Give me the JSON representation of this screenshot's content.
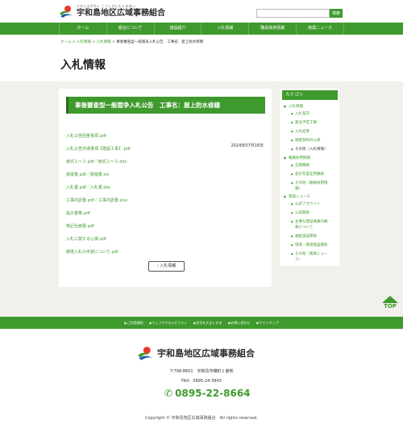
{
  "header": {
    "logo_kana": "うわじまがちく こうしきじむくみあい",
    "logo_name": "宇和島地区広域事務組合",
    "search_placeholder": "",
    "search_button": "検索"
  },
  "nav": [
    "ホーム",
    "組合について",
    "施設紹介",
    "入札情報",
    "職員採用情報",
    "南風ニュース"
  ],
  "breadcrumb": {
    "home": "ホーム",
    "sep": " > ",
    "l1": "入札情報",
    "l2": "入札情報",
    "current": "事後審査型一般競争入札公告　工事名：屋上防水修繕"
  },
  "page_title": "入札情報",
  "notice": {
    "title": "事後審査型一般競争入札公告　工事名：屋上防水修繕",
    "date": "2024年07月16日",
    "docs": [
      "入札公告回答事項.pdf",
      "入札公告共通事項【建設工事】.pdf",
      "様式１～３.pdf／様式１～３.doc",
      "質疑書.pdf／質疑書.xls",
      "入札書.pdf／入札書.doc",
      "工事内訳書.pdf／工事内訳書.xlsx",
      "設計書等.pdf",
      "特記仕様書.pdf",
      "入札に関する心得.pdf",
      "郵便入札の手続について.pdf"
    ],
    "back_label": "入札情報"
  },
  "sidebar": {
    "heading": "カテゴリ",
    "items": [
      {
        "label": "入札情報",
        "level": 1
      },
      {
        "label": "入札案内",
        "level": 2
      },
      {
        "label": "発注予定工事",
        "level": 2
      },
      {
        "label": "入札結果",
        "level": 2
      },
      {
        "label": "随意契約の公表",
        "level": 2
      },
      {
        "label": "その他（入札情報）",
        "level": 2
      },
      {
        "label": "職員採用情報",
        "level": 1
      },
      {
        "label": "正規職員",
        "level": 2
      },
      {
        "label": "会計年度任用職員",
        "level": 2
      },
      {
        "label": "その他（職員採用情",
        "level": 2
      },
      {
        "label": "報）",
        "level": 3
      },
      {
        "label": "南風ニュース",
        "level": 1
      },
      {
        "label": "公式アカウント",
        "level": 2
      },
      {
        "label": "公表関係",
        "level": 2
      },
      {
        "label": "主要な建設事業の概",
        "level": 2
      },
      {
        "label": "要について",
        "level": 3
      },
      {
        "label": "福祉施設関係",
        "level": 2
      },
      {
        "label": "環境・資源施設関係",
        "level": 2
      },
      {
        "label": "その他（南風ニュー",
        "level": 2
      },
      {
        "label": "ス）",
        "level": 3
      }
    ]
  },
  "top_label": "TOP",
  "footer_links": [
    "ご利用規約",
    "ウェブアクセシビリティ",
    "文字を大きくする",
    "お問い合わせ",
    "サイトマップ"
  ],
  "footer": {
    "name": "宇和島地区広域事務組合",
    "address": "〒798-8601　宇和島市曙町１番地",
    "fax": "FAX：0895-24-3943",
    "phone": "0895-22-8664",
    "copyright": "Copyright © 宇和島地区広域事務組合　All rights reserved."
  },
  "colors": {
    "brand_green": "#3f9a2d",
    "content_bg": "#f1f0eb"
  }
}
